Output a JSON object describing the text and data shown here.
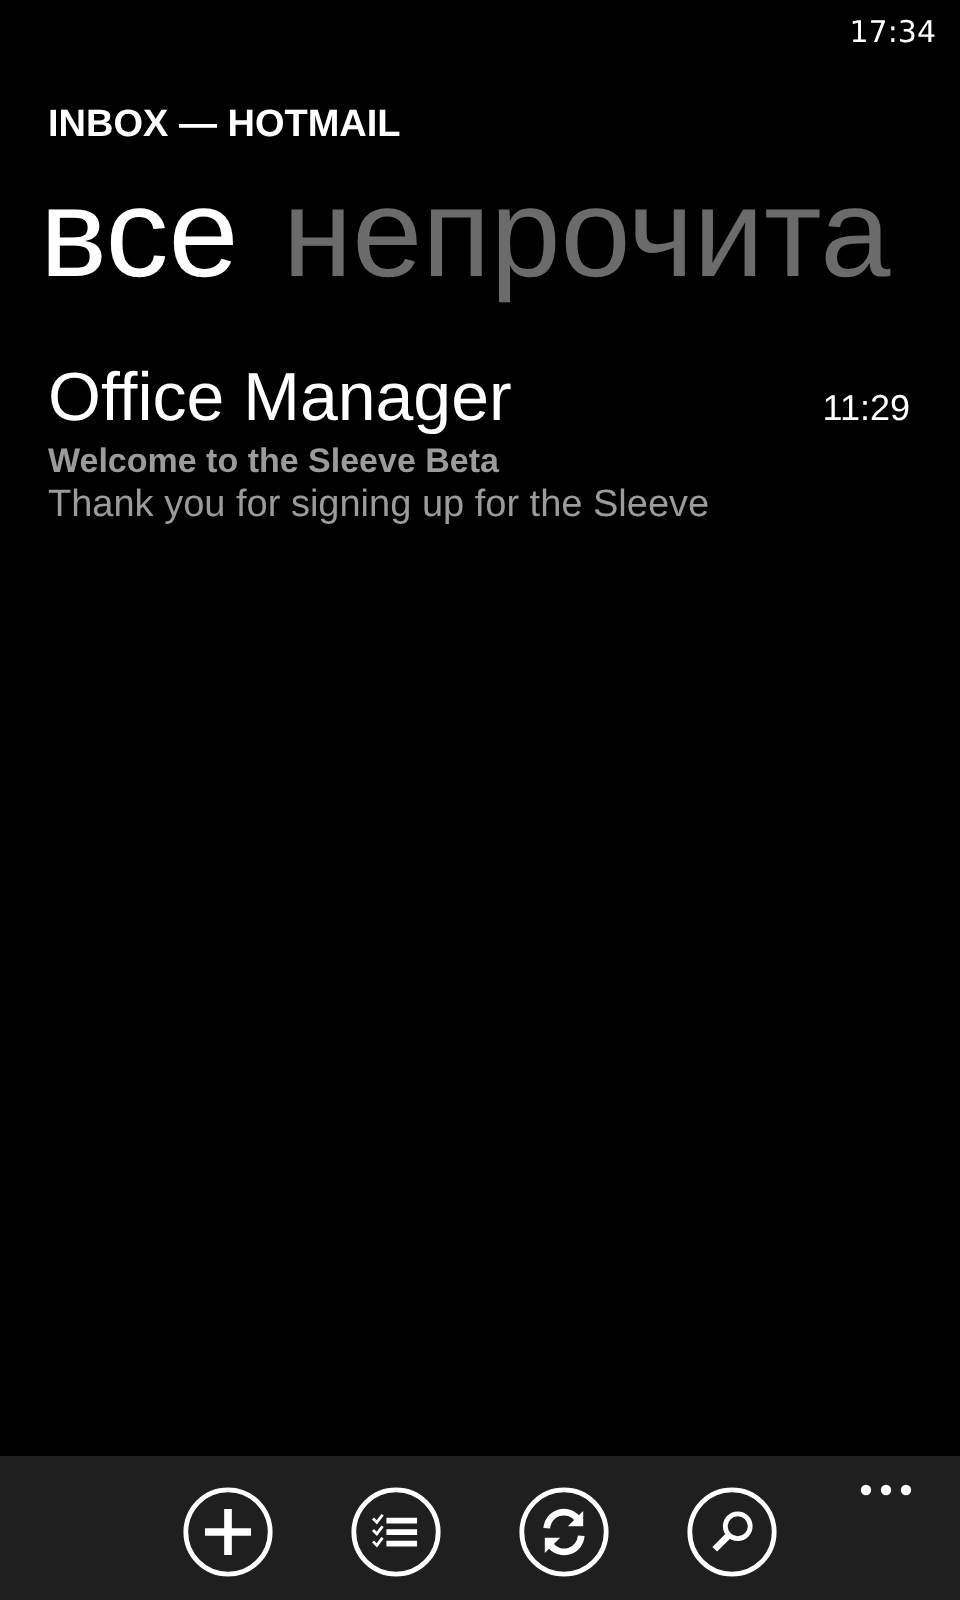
{
  "status_bar": {
    "time": "17:34"
  },
  "title": "INBOX — HOTMAIL",
  "pivot": [
    {
      "label": "все",
      "selected": true
    },
    {
      "label": "непрочита",
      "selected": false
    }
  ],
  "messages": [
    {
      "sender": "Office Manager",
      "time": "11:29",
      "subject": "Welcome to the Sleeve Beta",
      "preview": "Thank you for signing up for the Sleeve"
    }
  ],
  "app_bar": {
    "buttons": [
      {
        "kind": "new"
      },
      {
        "kind": "select"
      },
      {
        "kind": "sync"
      },
      {
        "kind": "search"
      }
    ],
    "more": true
  }
}
